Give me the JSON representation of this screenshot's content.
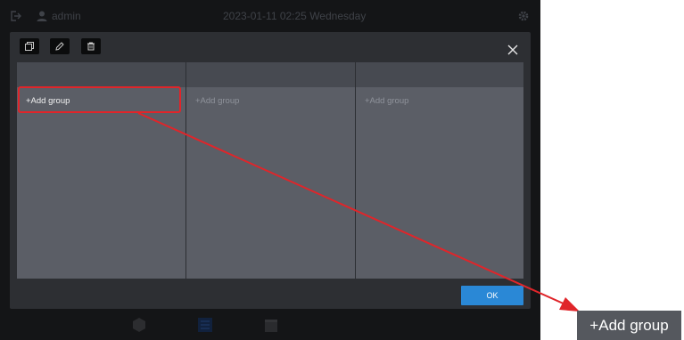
{
  "topbar": {
    "username": "admin",
    "datetime": "2023-01-11 02:25 Wednesday",
    "icons": [
      "exit-icon",
      "user-icon",
      "gear-icon"
    ]
  },
  "dialog": {
    "toolbar": {
      "icons": [
        "copy-icon",
        "edit-icon",
        "delete-icon"
      ]
    },
    "close_icon": "close-icon",
    "columns": [
      {
        "add_label": "+Add group",
        "state": "active"
      },
      {
        "add_label": "+Add group",
        "state": "inactive"
      },
      {
        "add_label": "+Add group",
        "state": "inactive"
      }
    ],
    "ok_label": "OK"
  },
  "bottombar": {
    "icons": [
      "cube-icon",
      "list-icon",
      "calendar-icon"
    ]
  },
  "annotation": {
    "callout_text": "+Add group",
    "highlight_color": "#e0252a"
  },
  "colors": {
    "screen_bg": "#141517",
    "dialog_bg": "#2d2f33",
    "table_bg": "#5b5e66",
    "header_bg": "#474a51",
    "ok_button": "#2a88d6",
    "arrow_red": "#e0252a"
  }
}
